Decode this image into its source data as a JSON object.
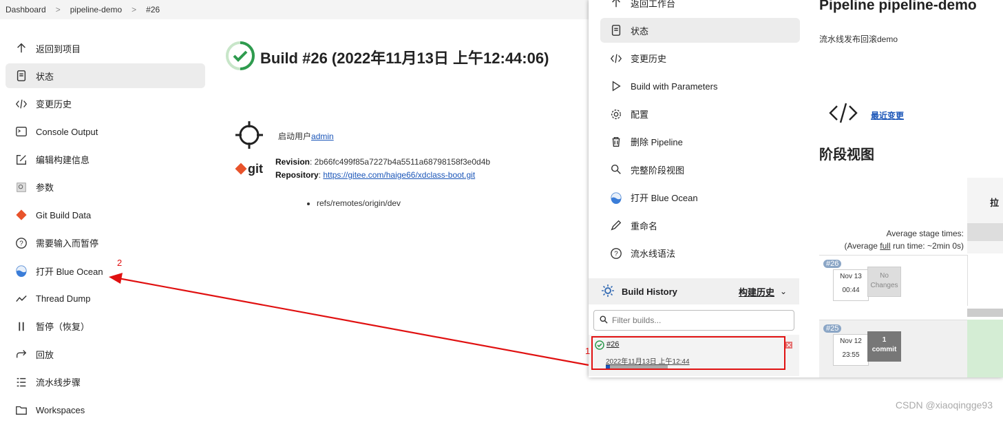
{
  "breadcrumb": [
    "Dashboard",
    "pipeline-demo",
    "#26"
  ],
  "left_nav": [
    {
      "label": "返回到项目",
      "icon": "arrow-up-icon"
    },
    {
      "label": "状态",
      "icon": "document-icon"
    },
    {
      "label": "变更历史",
      "icon": "code-icon"
    },
    {
      "label": "Console Output",
      "icon": "terminal-icon"
    },
    {
      "label": "编辑构建信息",
      "icon": "edit-icon"
    },
    {
      "label": "参数",
      "icon": "parameters-icon"
    },
    {
      "label": "Git Build Data",
      "icon": "git-icon"
    },
    {
      "label": "需要输入而暂停",
      "icon": "question-icon"
    },
    {
      "label": "打开 Blue Ocean",
      "icon": "blue-ocean-icon"
    },
    {
      "label": "Thread Dump",
      "icon": "thread-icon"
    },
    {
      "label": "暂停（恢复）",
      "icon": "pause-icon"
    },
    {
      "label": "回放",
      "icon": "replay-icon"
    },
    {
      "label": "流水线步骤",
      "icon": "steps-icon"
    },
    {
      "label": "Workspaces",
      "icon": "folder-icon"
    }
  ],
  "build": {
    "title": "Build #26 (2022年11月13日 上午12:44:06)",
    "started_by_prefix": "启动用户",
    "started_by_user": "admin",
    "revision_label": "Revision",
    "revision": ": 2b66fc499f85a7227b4a5511a68798158f3e0d4b",
    "repository_label": "Repository",
    "repository": "https://gitee.com/haige66/xdclass-boot.git",
    "git_logo": "git",
    "refs": [
      "refs/remotes/origin/dev"
    ]
  },
  "overlay_nav": [
    {
      "label": "返回工作台",
      "icon": "arrow-up-icon"
    },
    {
      "label": "状态",
      "icon": "document-icon"
    },
    {
      "label": "变更历史",
      "icon": "code-icon"
    },
    {
      "label": "Build with Parameters",
      "icon": "play-icon"
    },
    {
      "label": "配置",
      "icon": "gear-icon"
    },
    {
      "label": "删除 Pipeline",
      "icon": "trash-icon"
    },
    {
      "label": "完整阶段视图",
      "icon": "search-icon"
    },
    {
      "label": "打开 Blue Ocean",
      "icon": "blue-ocean-icon"
    },
    {
      "label": "重命名",
      "icon": "pencil-icon"
    },
    {
      "label": "流水线语法",
      "icon": "question-icon"
    }
  ],
  "build_history": {
    "title": "Build History",
    "hist_link": "构建历史",
    "filter_placeholder": "Filter builds...",
    "row_num": "#26",
    "row_date": "2022年11月13日 上午12:44",
    "progress": 0.07
  },
  "pipeline": {
    "title": "Pipeline pipeline-demo",
    "desc": "流水线发布回滚demo",
    "recent_changes": "最近变更",
    "stage_view": "阶段视图",
    "avg_line1": "Average stage times:",
    "avg_line2_prefix": "(Average ",
    "avg_line2_link": "full",
    "avg_line2_suffix": " run time: ~2min 0s)",
    "stage_header": "拉",
    "runs": [
      {
        "tag": "#26",
        "date": "Nov 13",
        "time": "00:44",
        "changes": "No Changes"
      },
      {
        "tag": "#25",
        "date": "Nov 12",
        "time": "23:55",
        "changes_count": "1",
        "changes_unit": "commit"
      }
    ]
  },
  "annotations": {
    "one": "1",
    "two": "2"
  },
  "watermark": "CSDN @xiaoqingge93"
}
